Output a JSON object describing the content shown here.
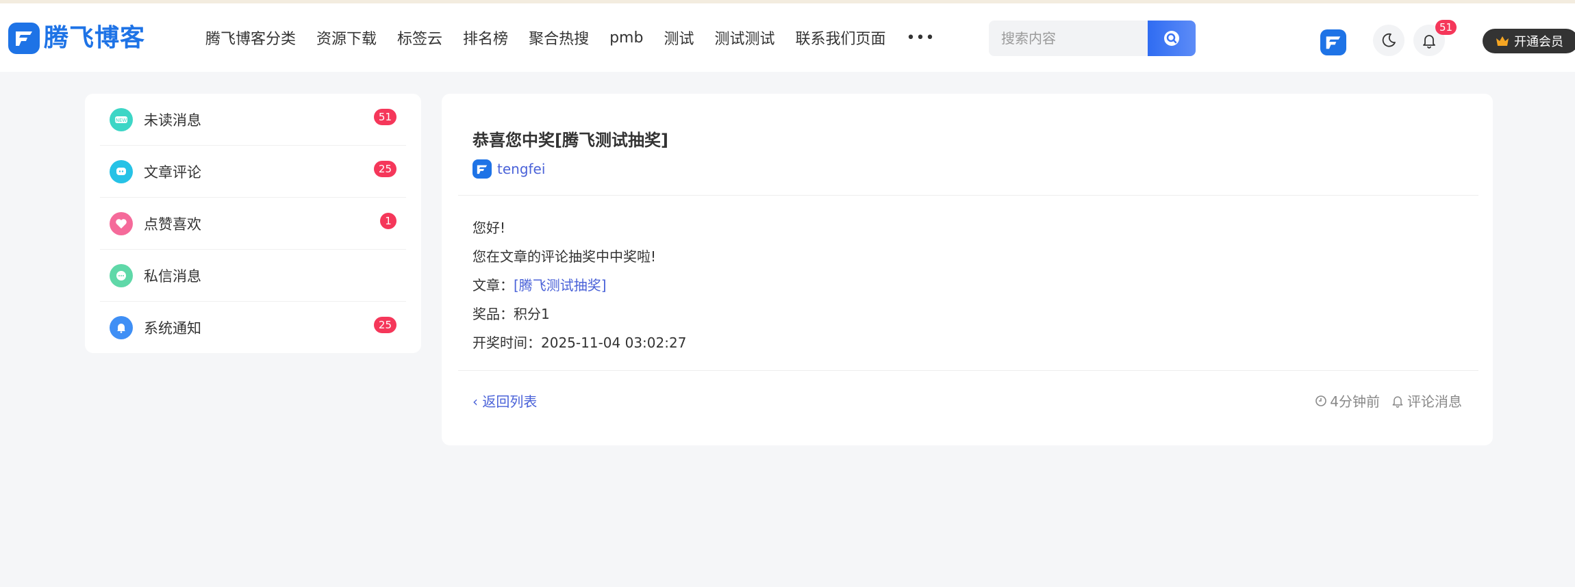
{
  "header": {
    "logo_text": "腾飞博客",
    "nav": [
      "腾飞博客分类",
      "资源下载",
      "标签云",
      "排名榜",
      "聚合热搜",
      "pmb",
      "测试",
      "测试测试",
      "联系我们页面"
    ],
    "more": "•••",
    "search_placeholder": "搜索内容",
    "notification_count": "51",
    "vip_label": "开通会员",
    "accent": "#1e73e6"
  },
  "sidebar": {
    "items": [
      {
        "label": "未读消息",
        "badge": "51",
        "icon": "new-icon",
        "color": "#3dd6c6"
      },
      {
        "label": "文章评论",
        "badge": "25",
        "icon": "chat-icon",
        "color": "#26c2e6"
      },
      {
        "label": "点赞喜欢",
        "badge": "1",
        "icon": "heart-icon",
        "color": "#f56a9a"
      },
      {
        "label": "私信消息",
        "badge": "",
        "icon": "message-icon",
        "color": "#5fd8a8"
      },
      {
        "label": "系统通知",
        "badge": "25",
        "icon": "bell-icon",
        "color": "#3f8ff5"
      }
    ]
  },
  "message": {
    "title": "恭喜您中奖[腾飞测试抽奖]",
    "author": "tengfei",
    "greeting": "您好!",
    "line1": "您在文章的评论抽奖中中奖啦!",
    "article_label": "文章：",
    "article_link": "[腾飞测试抽奖]",
    "prize_label": "奖品：",
    "prize_value": "积分1",
    "draw_time_label": "开奖时间：",
    "draw_time_value": "2025-11-04 03:02:27",
    "back_label": "返回列表",
    "time_ago": "4分钟前",
    "category": "评论消息"
  }
}
